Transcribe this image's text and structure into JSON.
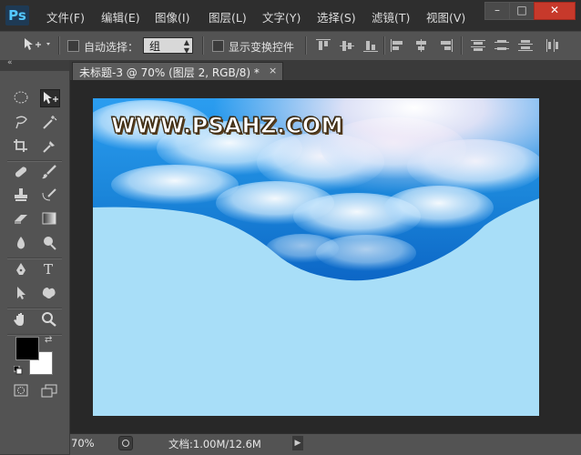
{
  "app": {
    "logo": "Ps"
  },
  "menu": [
    "文件(F)",
    "编辑(E)",
    "图像(I)",
    "图层(L)",
    "文字(Y)",
    "选择(S)",
    "滤镜(T)",
    "视图(V)"
  ],
  "window_controls": {
    "minimize": "–",
    "maximize": "□",
    "close": "✕"
  },
  "options": {
    "auto_select_label": "自动选择：",
    "auto_select_value": "组",
    "show_transform_label": "显示变换控件"
  },
  "document": {
    "tab_label": "未标题-3 @ 70% (图层 2, RGB/8) *",
    "tab_close": "×",
    "watermark": "WWW.PSAHZ.COM"
  },
  "status": {
    "zoom": "70%",
    "doc_info": "文档:1.00M/12.6M"
  },
  "colors": {
    "foreground": "#000000",
    "background": "#ffffff",
    "canvas_fill": "#a8def8",
    "sky_blue": "#1e8fe0"
  },
  "tools": [
    "marquee-icon",
    "move-icon",
    "lasso-icon",
    "magic-wand-icon",
    "crop-icon",
    "eyedropper-icon",
    "healing-brush-icon",
    "brush-icon",
    "stamp-icon",
    "history-brush-icon",
    "eraser-icon",
    "gradient-icon",
    "blur-icon",
    "dodge-icon",
    "pen-icon",
    "type-icon",
    "path-select-icon",
    "shape-icon",
    "hand-icon",
    "zoom-icon"
  ]
}
